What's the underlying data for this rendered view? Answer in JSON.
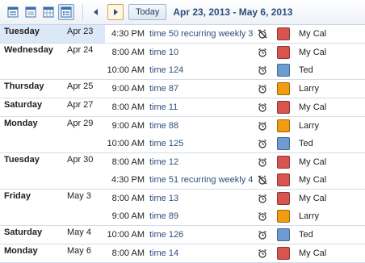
{
  "toolbar": {
    "views": [
      {
        "icon": "day-view-icon"
      },
      {
        "icon": "week-view-icon"
      },
      {
        "icon": "month-view-icon"
      },
      {
        "icon": "agenda-view-icon",
        "active": true
      }
    ],
    "prev_icon": "prev-arrow-icon",
    "next_icon": "next-arrow-icon",
    "today_label": "Today",
    "range": "Apr 23, 2013 - May 6, 2013"
  },
  "calendars": {
    "My Cal": "#d9534f",
    "Ted": "#6e9bd1",
    "Larry": "#f39c12"
  },
  "days": [
    {
      "name": "Tuesday",
      "date": "Apr 23",
      "selected": true,
      "events": [
        {
          "time": "4:30 PM",
          "title": "time 50 recurring weekly 3",
          "reminder": "off",
          "cal": "My Cal"
        }
      ]
    },
    {
      "name": "Wednesday",
      "date": "Apr 24",
      "events": [
        {
          "time": "8:00 AM",
          "title": "time 10",
          "reminder": "on",
          "cal": "My Cal"
        },
        {
          "time": "10:00 AM",
          "title": "time 124",
          "reminder": "on",
          "cal": "Ted"
        }
      ]
    },
    {
      "name": "Thursday",
      "date": "Apr 25",
      "events": [
        {
          "time": "9:00 AM",
          "title": "time 87",
          "reminder": "on",
          "cal": "Larry"
        }
      ]
    },
    {
      "name": "Saturday",
      "date": "Apr 27",
      "events": [
        {
          "time": "8:00 AM",
          "title": "time 11",
          "reminder": "on",
          "cal": "My Cal"
        }
      ]
    },
    {
      "name": "Monday",
      "date": "Apr 29",
      "events": [
        {
          "time": "9:00 AM",
          "title": "time 88",
          "reminder": "on",
          "cal": "Larry"
        },
        {
          "time": "10:00 AM",
          "title": "time 125",
          "reminder": "on",
          "cal": "Ted"
        }
      ]
    },
    {
      "name": "Tuesday",
      "date": "Apr 30",
      "events": [
        {
          "time": "8:00 AM",
          "title": "time 12",
          "reminder": "on",
          "cal": "My Cal"
        },
        {
          "time": "4:30 PM",
          "title": "time 51 recurring weekly 4",
          "reminder": "off",
          "cal": "My Cal"
        }
      ]
    },
    {
      "name": "Friday",
      "date": "May 3",
      "events": [
        {
          "time": "8:00 AM",
          "title": "time 13",
          "reminder": "on",
          "cal": "My Cal"
        },
        {
          "time": "9:00 AM",
          "title": "time 89",
          "reminder": "on",
          "cal": "Larry"
        }
      ]
    },
    {
      "name": "Saturday",
      "date": "May 4",
      "events": [
        {
          "time": "10:00 AM",
          "title": "time 126",
          "reminder": "on",
          "cal": "Ted"
        }
      ]
    },
    {
      "name": "Monday",
      "date": "May 6",
      "events": [
        {
          "time": "8:00 AM",
          "title": "time 14",
          "reminder": "on",
          "cal": "My Cal"
        }
      ]
    }
  ]
}
